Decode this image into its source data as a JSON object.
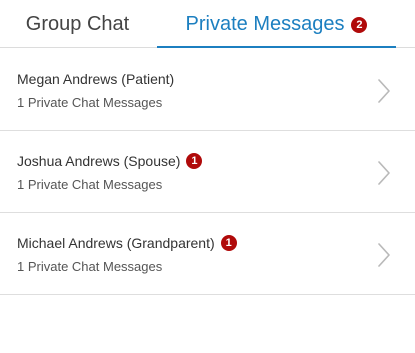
{
  "tabs": {
    "group_chat": {
      "label": "Group Chat",
      "active": false
    },
    "private_messages": {
      "label": "Private Messages",
      "badge": "2",
      "active": true
    }
  },
  "conversations": [
    {
      "name": "Megan Andrews (Patient)",
      "subtitle": "1 Private Chat Messages",
      "badge": ""
    },
    {
      "name": "Joshua Andrews (Spouse)",
      "subtitle": "1 Private Chat Messages",
      "badge": "1"
    },
    {
      "name": "Michael Andrews (Grandparent)",
      "subtitle": "1 Private Chat Messages",
      "badge": "1"
    }
  ],
  "colors": {
    "accent": "#1c7fc0",
    "badge": "#b00a0a",
    "divider": "#dedede"
  },
  "icons": {
    "row_action": "chevron-right-icon"
  }
}
